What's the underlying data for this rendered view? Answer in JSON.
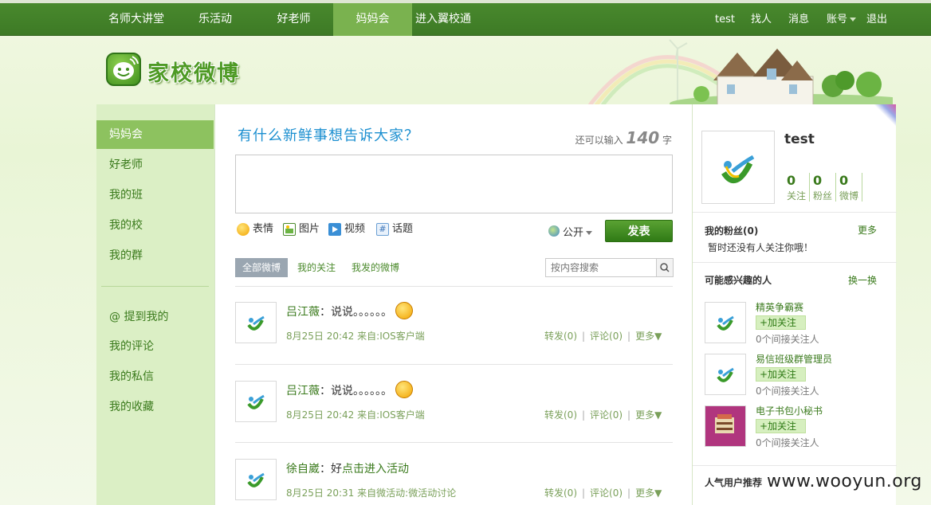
{
  "topnav": {
    "items": [
      "名师大讲堂",
      "乐活动",
      "好老师",
      "妈妈会",
      "进入翼校通"
    ],
    "active_index": 3,
    "right": {
      "user": "test",
      "find": "找人",
      "messages": "消息",
      "account": "账号",
      "logout": "退出"
    }
  },
  "header": {
    "logo_text": "家校微博"
  },
  "sidebar": {
    "items": [
      "妈妈会",
      "好老师",
      "我的班",
      "我的校",
      "我的群"
    ],
    "items2": [
      "@ 提到我的",
      "我的评论",
      "我的私信",
      "我的收藏"
    ],
    "active_index": 0
  },
  "composer": {
    "prompt": "有什么新鲜事想告诉大家？",
    "remaining_prefix": "还可以输入",
    "remaining_count": "140",
    "remaining_suffix": "字",
    "tools": {
      "emotion": "表情",
      "image": "图片",
      "video": "视频",
      "topic": "话题"
    },
    "visibility": "公开",
    "publish": "发表"
  },
  "filters": {
    "all": "全部微博",
    "following": "我的关注",
    "mine": "我发的微博",
    "search_placeholder": "按内容搜索"
  },
  "feed": [
    {
      "author": "吕江薇",
      "sep": "：",
      "text": "说说。。。。。。",
      "link": "",
      "time": "8月25日 20:42",
      "from_label": "来自:",
      "source": "IOS客户端",
      "repost": "转发(0)",
      "comment": "评论(0)",
      "more": "更多▼"
    },
    {
      "author": "吕江薇",
      "sep": "：",
      "text": "说说。。。。。。",
      "link": "",
      "time": "8月25日 20:42",
      "from_label": "来自:",
      "source": "IOS客户端",
      "repost": "转发(0)",
      "comment": "评论(0)",
      "more": "更多▼"
    },
    {
      "author": "徐自崴",
      "sep": "：",
      "text": "好",
      "link": "点击进入活动",
      "time": "8月25日 20:31",
      "from_label": "来自微活动:",
      "source": "微活动讨论",
      "repost": "转发(0)",
      "comment": "评论(0)",
      "more": "更多▼"
    }
  ],
  "profile": {
    "name": "test",
    "stats": [
      {
        "num": "0",
        "label": "关注"
      },
      {
        "num": "0",
        "label": "粉丝"
      },
      {
        "num": "0",
        "label": "微博"
      }
    ]
  },
  "fans": {
    "title": "我的粉丝(0)",
    "more": "更多",
    "empty": "暂时还没有人关注你哦！"
  },
  "suggest": {
    "title": "可能感兴趣的人",
    "refresh": "换一换",
    "follow_label": "+加关注",
    "users": [
      {
        "name": "精英争霸赛",
        "sub": "0个间接关注人"
      },
      {
        "name": "易信班级群管理员",
        "sub": "0个间接关注人"
      },
      {
        "name": "电子书包小秘书",
        "sub": "0个间接关注人"
      }
    ]
  },
  "popular": {
    "title": "人气用户推荐"
  },
  "watermark": "www.wooyun.org"
}
